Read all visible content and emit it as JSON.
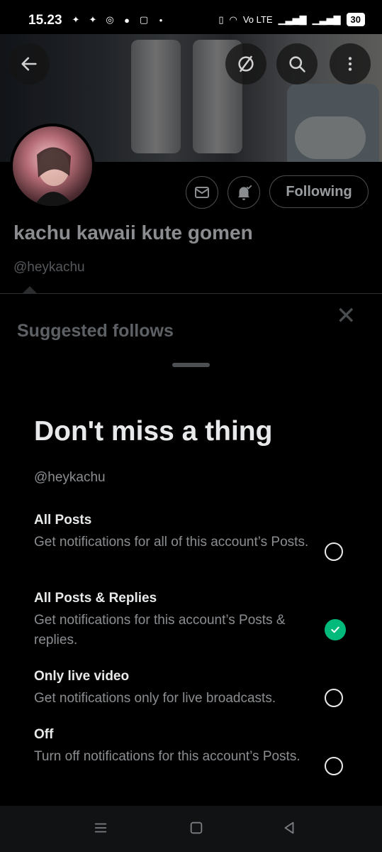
{
  "status_bar": {
    "time": "15.23",
    "battery": "30",
    "network": "Vo LTE"
  },
  "profile": {
    "name": "kachu kawaii kute gomen",
    "handle": "@heykachu",
    "following_label": "Following"
  },
  "suggested": {
    "title": "Suggested follows"
  },
  "sheet": {
    "title": "Don't miss a thing",
    "handle": "@heykachu",
    "options": [
      {
        "title": "All Posts",
        "desc": "Get notifications for all of this account’s Posts.",
        "selected": false
      },
      {
        "title": "All Posts & Replies",
        "desc": "Get notifications for this account’s Posts & replies.",
        "selected": true
      },
      {
        "title": "Only live video",
        "desc": "Get notifications only for live broadcasts.",
        "selected": false
      },
      {
        "title": "Off",
        "desc": "Turn off notifications for this account’s Posts.",
        "selected": false
      }
    ]
  },
  "colors": {
    "accent_green": "#00ba7c",
    "background": "#000000"
  },
  "icons": {
    "back": "back-arrow-icon",
    "hide": "slashed-circle-icon",
    "search": "search-icon",
    "more": "more-vertical-icon",
    "mail": "mail-icon",
    "bell": "bell-check-icon",
    "close": "close-icon",
    "nav_menu": "menu-icon",
    "nav_home": "home-square-icon",
    "nav_back": "back-triangle-icon"
  }
}
